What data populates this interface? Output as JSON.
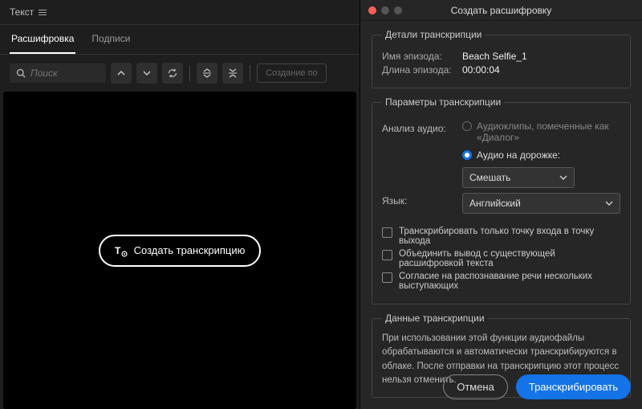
{
  "panel": {
    "title": "Текст",
    "tabs": [
      "Расшифровка",
      "Подписи"
    ],
    "search_placeholder": "Поиск",
    "disabled_button": "Создание по",
    "create_button": "Создать транскрипцию"
  },
  "dialog": {
    "title": "Создать расшифровку",
    "details": {
      "legend": "Детали транскрипции",
      "episode_name_label": "Имя эпизода:",
      "episode_name_value": "Beach Selfie_1",
      "episode_length_label": "Длина эпизода:",
      "episode_length_value": "00:00:04"
    },
    "params": {
      "legend": "Параметры транскрипции",
      "audio_analysis_label": "Анализ аудио:",
      "radio_dialog": "Аудиоклипы, помеченные как «Диалог»",
      "radio_track": "Аудио на дорожке:",
      "mix_select": "Смешать",
      "language_label": "Язык:",
      "language_value": "Английский",
      "check_inout": "Транскрибировать только точку входа в точку выхода",
      "check_merge": "Объединить вывод с существующей расшифровкой текста",
      "check_consent": "Согласие на распознавание речи нескольких выступающих"
    },
    "data": {
      "legend": "Данные транскрипции",
      "info": "При использовании этой функции аудиофайлы обрабатываются и автоматически транскрибируются в облаке. После отправки на транскрипцию этот процесс нельзя отменить."
    },
    "buttons": {
      "cancel": "Отмена",
      "transcribe": "Транскрибировать"
    }
  }
}
